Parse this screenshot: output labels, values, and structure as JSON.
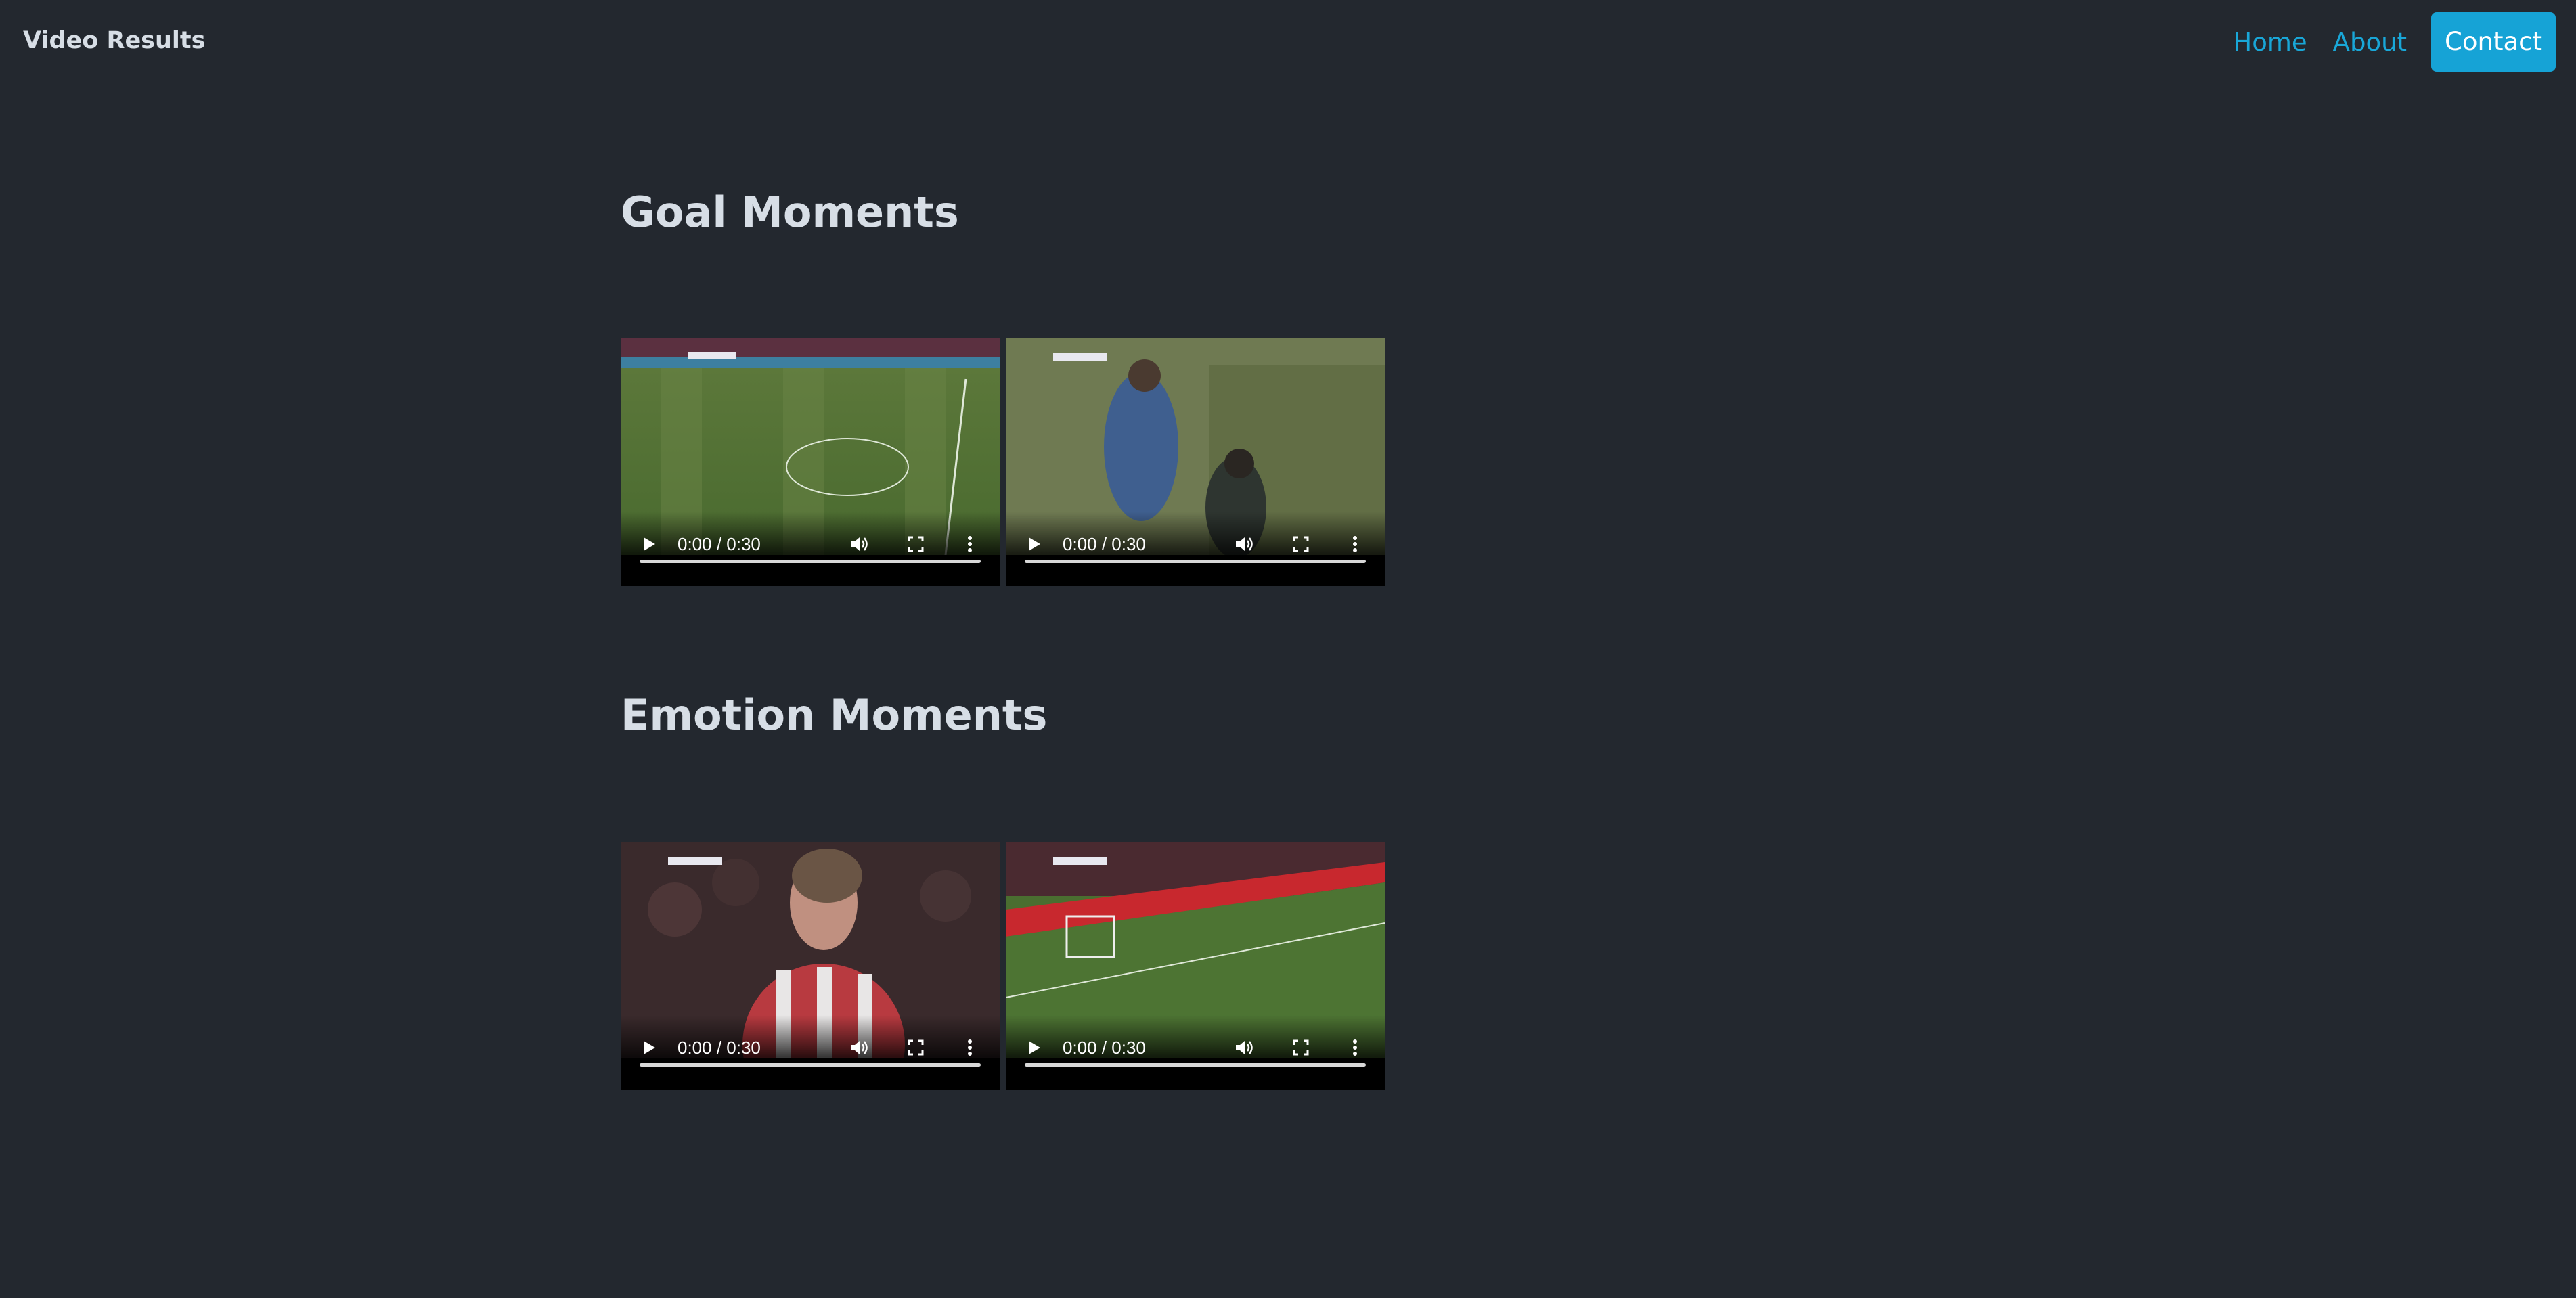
{
  "navbar": {
    "brand": "Video Results",
    "links": [
      {
        "label": "Home"
      },
      {
        "label": "About"
      }
    ],
    "cta": {
      "label": "Contact"
    }
  },
  "sections": [
    {
      "title": "Goal Moments",
      "videos": [
        {
          "time": "0:00 / 0:30",
          "progress": 0.0
        },
        {
          "time": "0:00 / 0:30",
          "progress": 0.0
        }
      ]
    },
    {
      "title": "Emotion Moments",
      "videos": [
        {
          "time": "0:00 / 0:30",
          "progress": 0.0
        },
        {
          "time": "0:00 / 0:30",
          "progress": 0.0
        }
      ]
    }
  ],
  "colors": {
    "background": "#23282f",
    "accent": "#16a3d6",
    "link": "#19a7d8",
    "text": "#d7dee6"
  },
  "icons": [
    "play-icon",
    "volume-icon",
    "fullscreen-icon",
    "more-options-icon"
  ]
}
